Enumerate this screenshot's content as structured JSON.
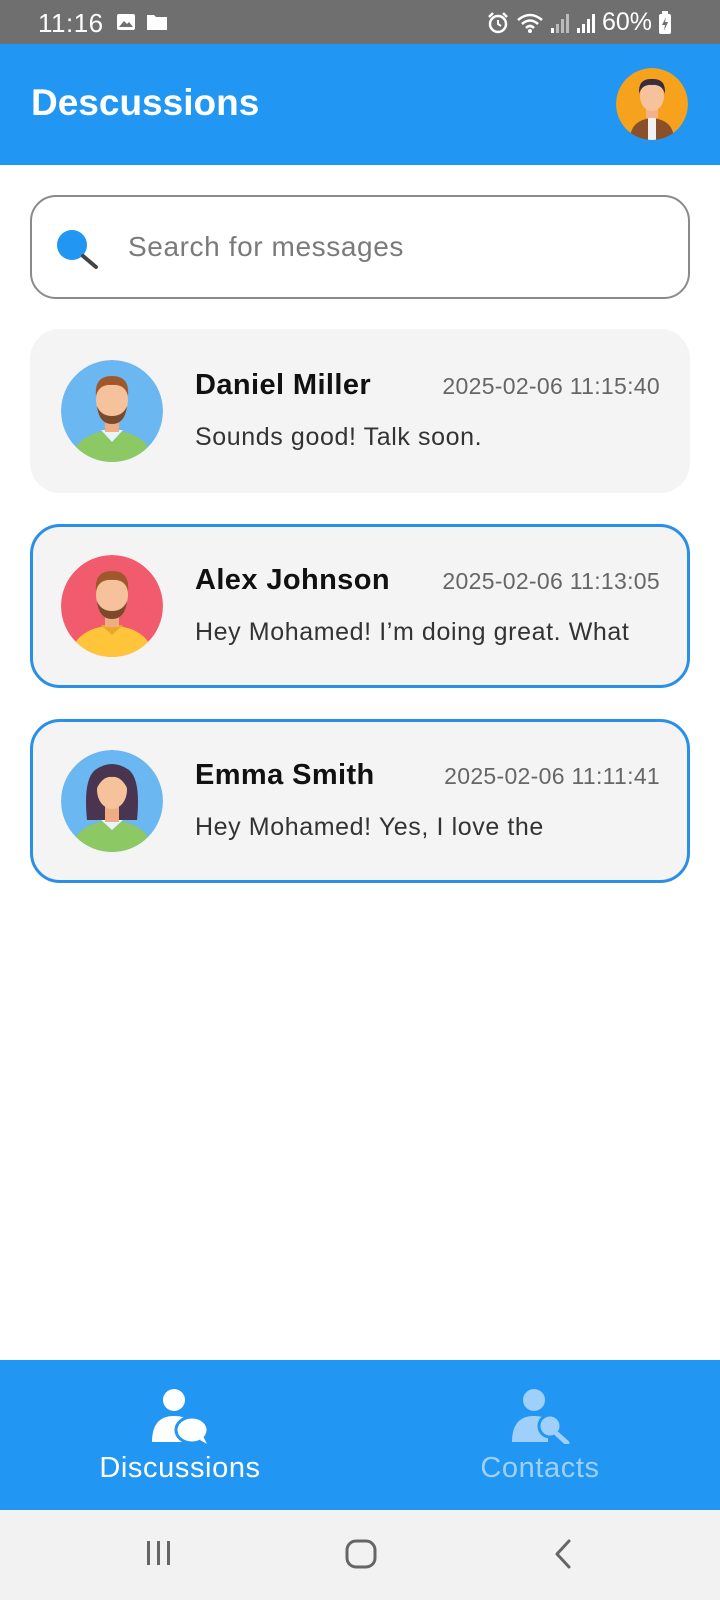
{
  "status_bar": {
    "time": "11:16",
    "battery": "60%",
    "icons": [
      "image-icon",
      "folder-icon",
      "alarm-icon",
      "wifi-icon",
      "signal-icon",
      "signal-icon",
      "battery-charging-icon"
    ]
  },
  "header": {
    "title": "Descussions",
    "avatar_icon": "user-avatar-icon"
  },
  "search": {
    "placeholder": "Search for messages",
    "value": "",
    "icon": "search-icon"
  },
  "chats": [
    {
      "name": "Daniel Miller",
      "time": "2025-02-06 11:15:40",
      "preview": "Sounds good! Talk soon.",
      "selected": false,
      "avatar_bg": "#6ab7f2",
      "shirt_color": "#8cc863"
    },
    {
      "name": "Alex Johnson",
      "time": "2025-02-06 11:13:05",
      "preview": "Hey Mohamed! I’m doing great. What",
      "selected": true,
      "avatar_bg": "#f25a6e",
      "shirt_color": "#ffc53a"
    },
    {
      "name": "Emma Smith",
      "time": "2025-02-06 11:11:41",
      "preview": "Hey Mohamed! Yes, I love the",
      "selected": true,
      "avatar_bg": "#6ab7f2",
      "shirt_color": "#8cc863"
    }
  ],
  "bottom_nav": {
    "items": [
      {
        "label": "Discussions",
        "icon": "discussions-icon",
        "active": true
      },
      {
        "label": "Contacts",
        "icon": "contacts-search-icon",
        "active": false
      }
    ]
  },
  "system_nav": {
    "buttons": [
      "recent-apps-icon",
      "home-icon",
      "back-icon"
    ]
  },
  "colors": {
    "primary": "#2196f3",
    "selected_border": "#2a8fe6",
    "card_bg": "#f4f4f5",
    "inactive_nav_label": "#9fd0fb"
  }
}
